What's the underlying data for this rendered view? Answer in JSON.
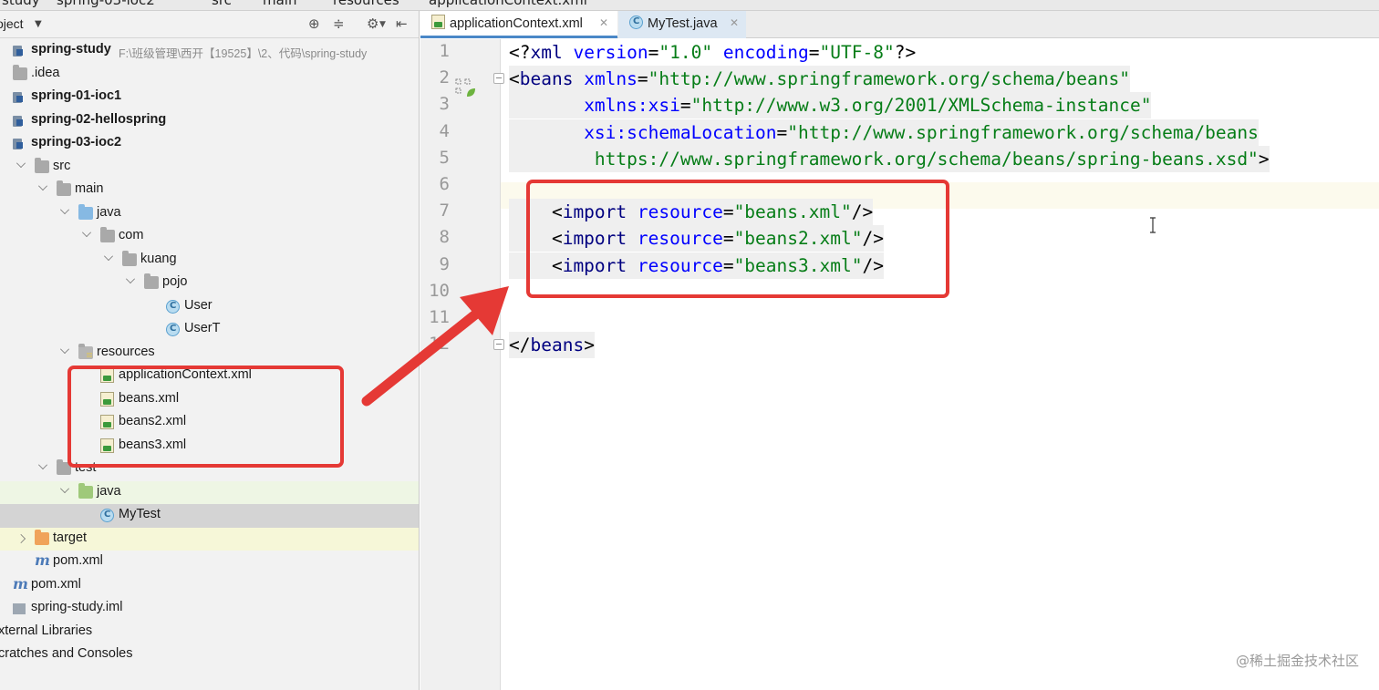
{
  "breadcrumb": [
    "study",
    "spring-03-ioc2",
    "src",
    "main",
    "resources",
    "applicationContext.xml"
  ],
  "project_panel": {
    "title": "oject",
    "tree": [
      {
        "label": "spring-study",
        "path": "F:\\班级管理\\西开【19525】\\2、代码\\spring-study",
        "bold": true,
        "icon": "module-icon",
        "arrow": "none",
        "indent": 0
      },
      {
        "label": ".idea",
        "icon": "folder-icon",
        "arrow": "none",
        "indent": 0
      },
      {
        "label": "spring-01-ioc1",
        "bold": true,
        "icon": "module-icon",
        "arrow": "none",
        "indent": 0
      },
      {
        "label": "spring-02-hellospring",
        "bold": true,
        "icon": "module-icon",
        "arrow": "none",
        "indent": 0
      },
      {
        "label": "spring-03-ioc2",
        "bold": true,
        "icon": "module-icon",
        "arrow": "none",
        "indent": 0
      },
      {
        "label": "src",
        "icon": "folder-icon",
        "arrow": "down",
        "indent": 1
      },
      {
        "label": "main",
        "icon": "folder-icon",
        "arrow": "down",
        "indent": 2
      },
      {
        "label": "java",
        "icon": "source-folder-icon",
        "arrow": "down",
        "indent": 3
      },
      {
        "label": "com",
        "icon": "package-icon",
        "arrow": "down",
        "indent": 4
      },
      {
        "label": "kuang",
        "icon": "package-icon",
        "arrow": "down",
        "indent": 5
      },
      {
        "label": "pojo",
        "icon": "package-icon",
        "arrow": "down",
        "indent": 6
      },
      {
        "label": "User",
        "icon": "class-icon",
        "arrow": "none",
        "indent": 7
      },
      {
        "label": "UserT",
        "icon": "class-icon",
        "arrow": "none",
        "indent": 7
      },
      {
        "label": "resources",
        "icon": "resources-folder-icon",
        "arrow": "down",
        "indent": 3
      },
      {
        "label": "applicationContext.xml",
        "icon": "xml-file-icon",
        "arrow": "none",
        "indent": 4
      },
      {
        "label": "beans.xml",
        "icon": "xml-file-icon",
        "arrow": "none",
        "indent": 4
      },
      {
        "label": "beans2.xml",
        "icon": "xml-file-icon",
        "arrow": "none",
        "indent": 4
      },
      {
        "label": "beans3.xml",
        "icon": "xml-file-icon",
        "arrow": "none",
        "indent": 4
      },
      {
        "label": "test",
        "icon": "folder-icon",
        "arrow": "down",
        "indent": 2
      },
      {
        "label": "java",
        "icon": "test-folder-icon",
        "arrow": "down",
        "indent": 3,
        "highlight": "green"
      },
      {
        "label": "MyTest",
        "icon": "class-icon",
        "arrow": "none",
        "indent": 4,
        "selected": true
      },
      {
        "label": "target",
        "icon": "target-folder-icon",
        "arrow": "right",
        "indent": 1,
        "highlight": "yellow"
      },
      {
        "label": "pom.xml",
        "icon": "maven-icon",
        "arrow": "none",
        "indent": 1
      },
      {
        "label": "pom.xml",
        "icon": "maven-icon",
        "arrow": "none",
        "indent": 0
      },
      {
        "label": "spring-study.iml",
        "icon": "iml-file-icon",
        "arrow": "none",
        "indent": 0
      },
      {
        "label": "xternal Libraries",
        "icon": "none",
        "arrow": "none",
        "indent": -1
      },
      {
        "label": "cratches and Consoles",
        "icon": "none",
        "arrow": "none",
        "indent": -1
      }
    ]
  },
  "tabs": [
    {
      "label": "applicationContext.xml",
      "active": true,
      "icon": "xml-file-icon"
    },
    {
      "label": "MyTest.java",
      "active": false,
      "icon": "class-icon"
    }
  ],
  "line_numbers": [
    "1",
    "2",
    "3",
    "4",
    "5",
    "6",
    "7",
    "8",
    "9",
    "10",
    "11",
    "12"
  ],
  "code_lines": [
    [
      {
        "t": "pi",
        "s": "<?"
      },
      {
        "t": "tag",
        "s": "xml "
      },
      {
        "t": "attr",
        "s": "version"
      },
      {
        "t": "pi",
        "s": "="
      },
      {
        "t": "val",
        "s": "\"1.0\" "
      },
      {
        "t": "attr",
        "s": "encoding"
      },
      {
        "t": "pi",
        "s": "="
      },
      {
        "t": "val",
        "s": "\"UTF-8\""
      },
      {
        "t": "pi",
        "s": "?>"
      }
    ],
    [
      {
        "t": "pi",
        "s": "<"
      },
      {
        "t": "tag",
        "s": "beans "
      },
      {
        "t": "attr",
        "s": "xmlns"
      },
      {
        "t": "pi",
        "s": "="
      },
      {
        "t": "val",
        "s": "\"http://www.springframework.org/schema/beans\""
      }
    ],
    [
      {
        "t": "pi",
        "s": "       "
      },
      {
        "t": "attr",
        "s": "xmlns:xsi"
      },
      {
        "t": "pi",
        "s": "="
      },
      {
        "t": "val",
        "s": "\"http://www.w3.org/2001/XMLSchema-instance\""
      }
    ],
    [
      {
        "t": "pi",
        "s": "       "
      },
      {
        "t": "attr",
        "s": "xsi:schemaLocation"
      },
      {
        "t": "pi",
        "s": "="
      },
      {
        "t": "val",
        "s": "\"http://www.springframework.org/schema/beans"
      }
    ],
    [
      {
        "t": "val",
        "s": "        https://www.springframework.org/schema/beans/spring-beans.xsd\""
      },
      {
        "t": "pi",
        "s": ">"
      }
    ],
    [],
    [
      {
        "t": "pi",
        "s": "    <"
      },
      {
        "t": "tag",
        "s": "import "
      },
      {
        "t": "attr",
        "s": "resource"
      },
      {
        "t": "pi",
        "s": "="
      },
      {
        "t": "val",
        "s": "\"beans.xml\""
      },
      {
        "t": "pi",
        "s": "/>"
      }
    ],
    [
      {
        "t": "pi",
        "s": "    <"
      },
      {
        "t": "tag",
        "s": "import "
      },
      {
        "t": "attr",
        "s": "resource"
      },
      {
        "t": "pi",
        "s": "="
      },
      {
        "t": "val",
        "s": "\"beans2.xml\""
      },
      {
        "t": "pi",
        "s": "/>"
      }
    ],
    [
      {
        "t": "pi",
        "s": "    <"
      },
      {
        "t": "tag",
        "s": "import "
      },
      {
        "t": "attr",
        "s": "resource"
      },
      {
        "t": "pi",
        "s": "="
      },
      {
        "t": "val",
        "s": "\"beans3.xml\""
      },
      {
        "t": "pi",
        "s": "/>"
      }
    ],
    [],
    [],
    [
      {
        "t": "pi",
        "s": "</"
      },
      {
        "t": "tag",
        "s": "beans"
      },
      {
        "t": "pi",
        "s": ">"
      }
    ]
  ],
  "watermark": "@稀土掘金技术社区",
  "colors": {
    "annotation_red": "#e53935",
    "xml_tag": "#000080",
    "xml_attr": "#0000ff",
    "xml_value": "#067d17"
  }
}
